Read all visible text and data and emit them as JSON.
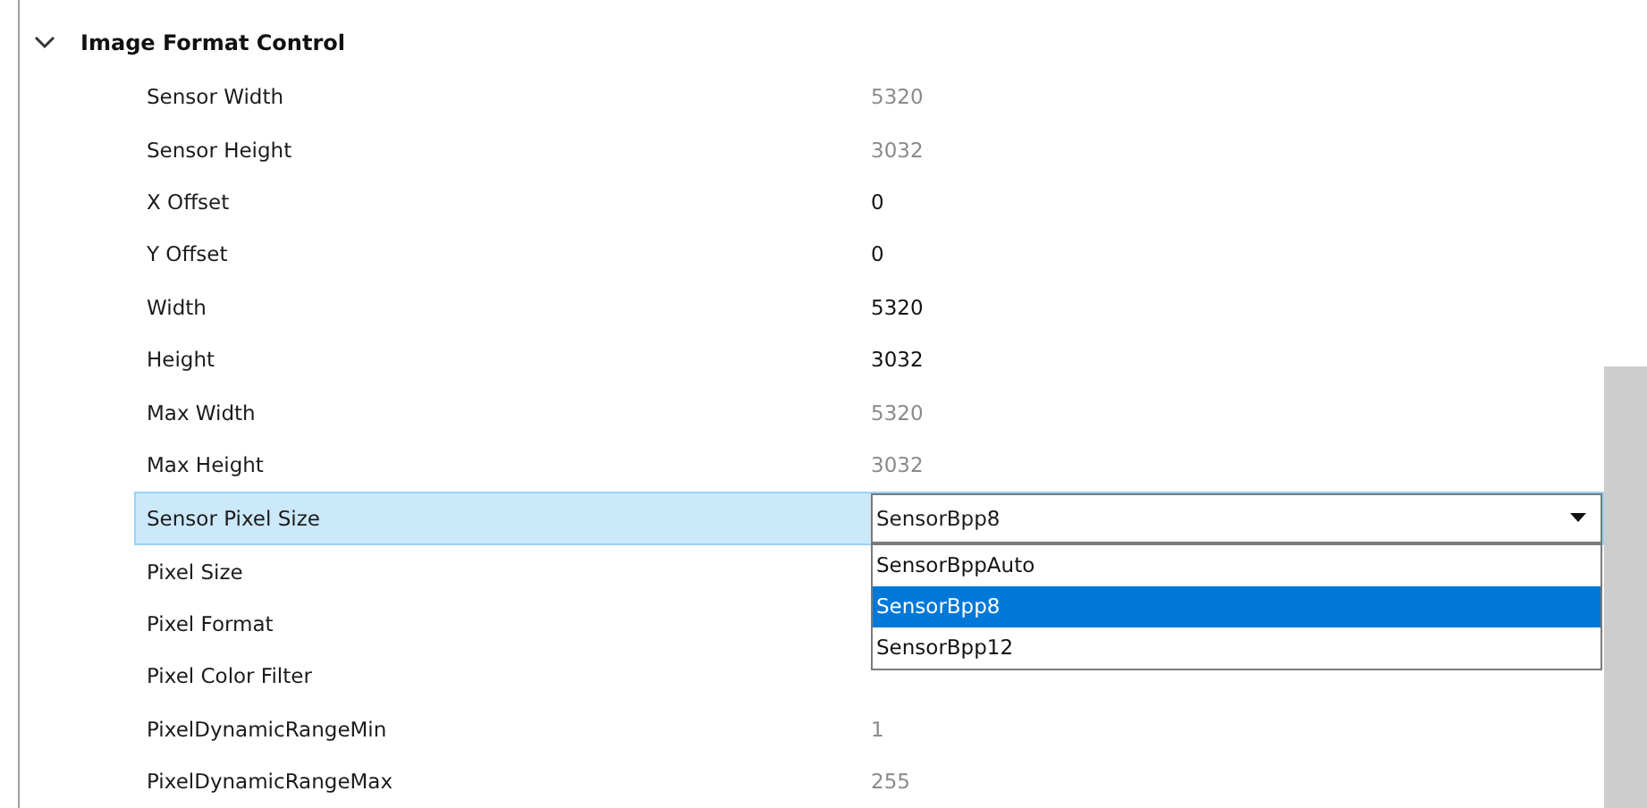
{
  "category": {
    "title": "Image Format Control",
    "expanded": true
  },
  "rows": [
    {
      "kind": "value",
      "label": "Sensor Width",
      "value": "5320",
      "editable": false
    },
    {
      "kind": "value",
      "label": "Sensor Height",
      "value": "3032",
      "editable": false
    },
    {
      "kind": "value",
      "label": "X Offset",
      "value": "0",
      "editable": true
    },
    {
      "kind": "value",
      "label": "Y Offset",
      "value": "0",
      "editable": true
    },
    {
      "kind": "value",
      "label": "Width",
      "value": "5320",
      "editable": true
    },
    {
      "kind": "value",
      "label": "Height",
      "value": "3032",
      "editable": true
    },
    {
      "kind": "value",
      "label": "Max Width",
      "value": "5320",
      "editable": false
    },
    {
      "kind": "value",
      "label": "Max Height",
      "value": "3032",
      "editable": false
    },
    {
      "kind": "dropdown",
      "label": "Sensor Pixel Size",
      "value": "SensorBpp8",
      "selected": true,
      "options": [
        {
          "label": "SensorBppAuto",
          "selected": false
        },
        {
          "label": "SensorBpp8",
          "selected": true
        },
        {
          "label": "SensorBpp12",
          "selected": false
        }
      ]
    },
    {
      "kind": "value",
      "label": "Pixel Size"
    },
    {
      "kind": "value",
      "label": "Pixel Format"
    },
    {
      "kind": "value",
      "label": "Pixel Color Filter"
    },
    {
      "kind": "value",
      "label": "PixelDynamicRangeMin",
      "value": "1",
      "editable": false
    },
    {
      "kind": "value",
      "label": "PixelDynamicRangeMax",
      "value": "255",
      "editable": false
    }
  ]
}
